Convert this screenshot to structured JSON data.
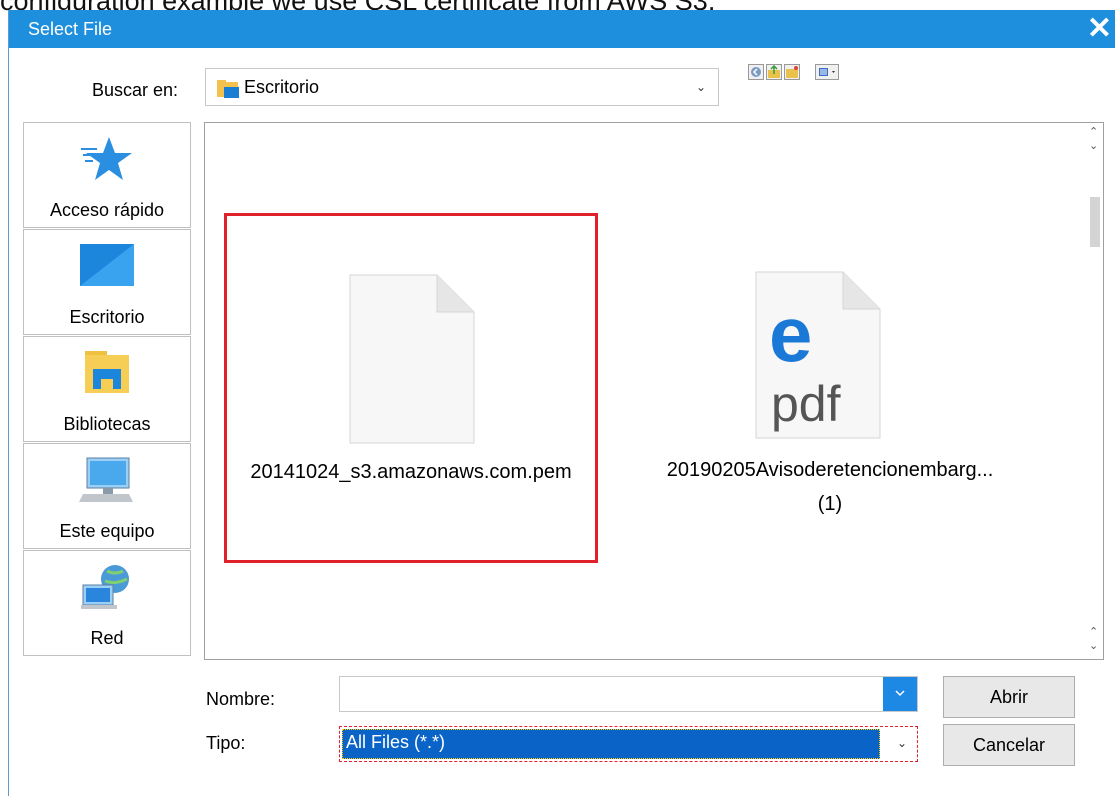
{
  "background_caption": "configuration example we use CSL certificate from AWS S3.",
  "dialog": {
    "title": "Select File",
    "close_symbol": "✕"
  },
  "lookin": {
    "label": "Buscar en:",
    "value": "Escritorio"
  },
  "toolbar": [
    "back-icon",
    "up-folder-icon",
    "new-folder-icon",
    "view-menu-icon"
  ],
  "places": [
    {
      "label": "Acceso rápido",
      "icon": "star-icon"
    },
    {
      "label": "Escritorio",
      "icon": "desktop-icon"
    },
    {
      "label": "Bibliotecas",
      "icon": "library-icon"
    },
    {
      "label": "Este equipo",
      "icon": "computer-icon"
    },
    {
      "label": "Red",
      "icon": "network-icon"
    }
  ],
  "files": [
    {
      "name": "20141024_s3.amazonaws.com.pem",
      "icon": "blank-file-icon",
      "selected": true
    },
    {
      "name": "20190205Avisoderetencionembarg...",
      "name_line2": "(1)",
      "icon": "edge-pdf-icon",
      "pdf_text": "pdf"
    }
  ],
  "filename": {
    "label": "Nombre:",
    "value": ""
  },
  "filetype": {
    "label": "Tipo:",
    "value": "All Files (*.*)"
  },
  "buttons": {
    "open": "Abrir",
    "cancel": "Cancelar"
  },
  "colors": {
    "titlebar": "#1e8fdc",
    "selection_box": "#e0202a",
    "type_highlight": "#0a64c8"
  }
}
